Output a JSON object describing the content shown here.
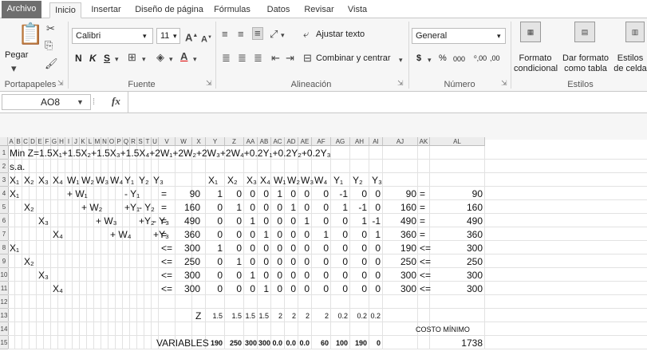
{
  "tabs": [
    "Archivo",
    "Inicio",
    "Insertar",
    "Diseño de página",
    "Fórmulas",
    "Datos",
    "Revisar",
    "Vista"
  ],
  "ribbon": {
    "paste": "Pegar",
    "font_name": "Calibri",
    "font_size": "11",
    "bold": "N",
    "italic": "K",
    "underline": "S",
    "wrap_text": "Ajustar texto",
    "merge": "Combinar y centrar",
    "number_format": "General",
    "currency": "$",
    "percent": "%",
    "thousands": "000",
    "dec_inc": "⁰,00",
    "dec_dec": ",00",
    "cond_format": "Formato condicional",
    "table_format": "Dar formato como tabla",
    "cell_styles": "Estilos de celda",
    "groups": {
      "clipboard": "Portapapeles",
      "font": "Fuente",
      "alignment": "Alineación",
      "number": "Número",
      "styles": "Estilos"
    }
  },
  "formula_bar": {
    "name_box": "AO8",
    "fx": "fx"
  },
  "columns": [
    "A",
    "B",
    "C",
    "D",
    "E",
    "F",
    "G",
    "H",
    "I",
    "J",
    "K",
    "L",
    "M",
    "N",
    "O",
    "P",
    "Q",
    "R",
    "S",
    "T",
    "U",
    "V",
    "W",
    "X",
    "Y",
    "Z",
    "AA",
    "AB",
    "AC",
    "AD",
    "AE",
    "AF",
    "AG",
    "AH",
    "AI",
    "AJ",
    "AK",
    "AL"
  ],
  "rows": [
    "1",
    "2",
    "3",
    "4",
    "5",
    "6",
    "7",
    "8",
    "9",
    "10",
    "11",
    "12",
    "13",
    "14",
    "15"
  ],
  "sheet": {
    "objective": "Min Z=1.5X₁+1.5X₂+1.5X₃+1.5X₄+2W₁+2W₂+2W₃+2W₄+0.2Y₁+0.2Y₂+0.2Y₃",
    "sa": "s.a.",
    "var_headers": [
      "X₁",
      "X₂",
      "X₃",
      "X₄",
      "W₁",
      "W₂",
      "W₃",
      "W₄",
      "Y₁",
      "Y₂",
      "Y₃"
    ],
    "constraints_left": [
      [
        "X₁",
        "",
        "",
        "",
        "+ W₁",
        "",
        "",
        "",
        "- Y₁",
        "",
        ""
      ],
      [
        "",
        "X₂",
        "",
        "",
        "",
        "+ W₂",
        "",
        "",
        "+Y₁",
        "- Y₂",
        ""
      ],
      [
        "",
        "",
        "X₃",
        "",
        "",
        "",
        "+ W₃",
        "",
        "",
        "+Y₂",
        "- Y₃"
      ],
      [
        "",
        "",
        "",
        "X₄",
        "",
        "",
        "",
        "+ W₄",
        "",
        "",
        "+Y₃"
      ],
      [
        "X₁",
        "",
        "",
        "",
        "",
        "",
        "",
        "",
        "",
        "",
        ""
      ],
      [
        "",
        "X₂",
        "",
        "",
        "",
        "",
        "",
        "",
        "",
        "",
        ""
      ],
      [
        "",
        "",
        "X₃",
        "",
        "",
        "",
        "",
        "",
        "",
        "",
        ""
      ],
      [
        "",
        "",
        "",
        "X₄",
        "",
        "",
        "",
        "",
        "",
        "",
        ""
      ]
    ],
    "ops": [
      "=",
      "=",
      "=",
      "=",
      "<=",
      "<=",
      "<=",
      "<="
    ],
    "rhs": [
      "90",
      "160",
      "490",
      "360",
      "300",
      "250",
      "300",
      "300"
    ],
    "matrix": [
      [
        "1",
        "0",
        "0",
        "0",
        "1",
        "0",
        "0",
        "0",
        "-1",
        "0",
        "0"
      ],
      [
        "0",
        "1",
        "0",
        "0",
        "0",
        "1",
        "0",
        "0",
        "1",
        "-1",
        "0"
      ],
      [
        "0",
        "0",
        "1",
        "0",
        "0",
        "0",
        "1",
        "0",
        "0",
        "1",
        "-1"
      ],
      [
        "0",
        "0",
        "0",
        "1",
        "0",
        "0",
        "0",
        "1",
        "0",
        "0",
        "1"
      ],
      [
        "1",
        "0",
        "0",
        "0",
        "0",
        "0",
        "0",
        "0",
        "0",
        "0",
        "0"
      ],
      [
        "0",
        "1",
        "0",
        "0",
        "0",
        "0",
        "0",
        "0",
        "0",
        "0",
        "0"
      ],
      [
        "0",
        "0",
        "1",
        "0",
        "0",
        "0",
        "0",
        "0",
        "0",
        "0",
        "0"
      ],
      [
        "0",
        "0",
        "0",
        "1",
        "0",
        "0",
        "0",
        "0",
        "0",
        "0",
        "0"
      ]
    ],
    "lhs_values": [
      "90",
      "160",
      "490",
      "360",
      "190",
      "250",
      "300",
      "300"
    ],
    "lhs_ops": [
      "=",
      "=",
      "=",
      "=",
      "<=",
      "<=",
      "<=",
      "<="
    ],
    "rhs_values": [
      "90",
      "160",
      "490",
      "360",
      "300",
      "250",
      "300",
      "300"
    ],
    "z_label": "Z",
    "z_coefs": [
      "1.5",
      "1.5",
      "1.5",
      "1.5",
      "2",
      "2",
      "2",
      "2",
      "0.2",
      "0.2",
      "0.2"
    ],
    "variables_label": "VARIABLES",
    "variables": [
      "190",
      "250",
      "300",
      "300",
      "0.0",
      "0.0",
      "0.0",
      "60",
      "100",
      "190",
      "0"
    ],
    "cost_label": "COSTO MÍNIMO",
    "cost_value": "1738"
  }
}
